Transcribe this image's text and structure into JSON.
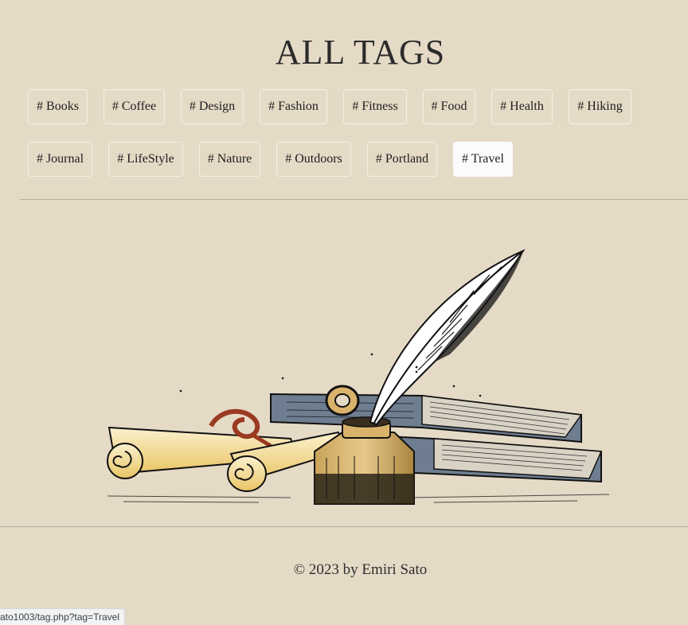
{
  "page": {
    "title": "ALL TAGS"
  },
  "tags": [
    "# Books",
    "# Coffee",
    "# Design",
    "# Fashion",
    "# Fitness",
    "# Food",
    "# Health",
    "# Hiking",
    "# Journal",
    "# LifeStyle",
    "# Nature",
    "# Outdoors",
    "# Portland",
    "# Travel"
  ],
  "active_tag": "# Travel",
  "illustration": {
    "icon": "quill-inkwell-books-scrolls-illustration"
  },
  "footer": {
    "copyright": "© 2023 by Emiri Sato"
  },
  "status_bar": {
    "url": "ato1003/tag.php?tag=Travel"
  },
  "colors": {
    "background": "#e5dac6",
    "active_tag_bg": "#fafbfc",
    "tag_border": "#f5efe4"
  }
}
